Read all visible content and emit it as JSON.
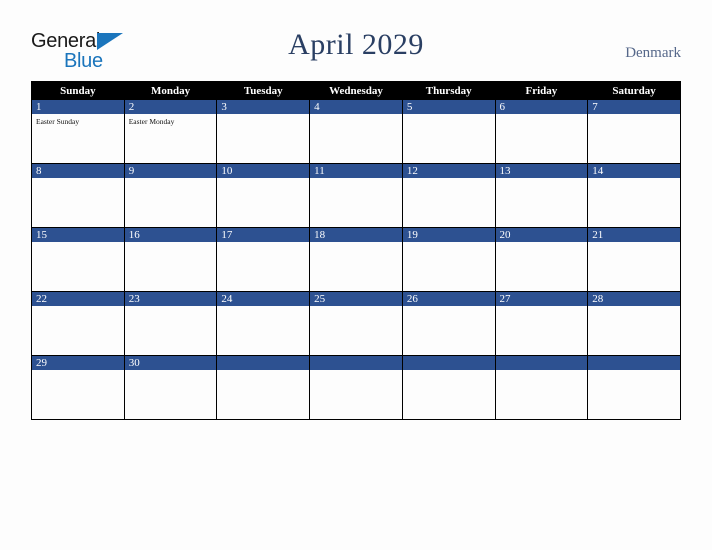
{
  "brand": {
    "word_one": "General",
    "word_two": "Blue",
    "triangle_icon": "triangle-icon",
    "accent_color": "#1b75bc"
  },
  "header": {
    "title": "April 2029",
    "country": "Denmark",
    "title_color": "#2a3f63",
    "country_color": "#56688a"
  },
  "calendar": {
    "weekday_headers": [
      "Sunday",
      "Monday",
      "Tuesday",
      "Wednesday",
      "Thursday",
      "Friday",
      "Saturday"
    ],
    "header_bg": "#000000",
    "header_text_color": "#ffffff",
    "daynum_bar_color": "#2d5191",
    "daynum_text_color": "#ffffff",
    "grid_line_color": "#000000",
    "cell_bg": "#fdfdfd",
    "weeks": [
      [
        {
          "day": "1",
          "events": [
            "Easter Sunday"
          ]
        },
        {
          "day": "2",
          "events": [
            "Easter Monday"
          ]
        },
        {
          "day": "3",
          "events": []
        },
        {
          "day": "4",
          "events": []
        },
        {
          "day": "5",
          "events": []
        },
        {
          "day": "6",
          "events": []
        },
        {
          "day": "7",
          "events": []
        }
      ],
      [
        {
          "day": "8",
          "events": []
        },
        {
          "day": "9",
          "events": []
        },
        {
          "day": "10",
          "events": []
        },
        {
          "day": "11",
          "events": []
        },
        {
          "day": "12",
          "events": []
        },
        {
          "day": "13",
          "events": []
        },
        {
          "day": "14",
          "events": []
        }
      ],
      [
        {
          "day": "15",
          "events": []
        },
        {
          "day": "16",
          "events": []
        },
        {
          "day": "17",
          "events": []
        },
        {
          "day": "18",
          "events": []
        },
        {
          "day": "19",
          "events": []
        },
        {
          "day": "20",
          "events": []
        },
        {
          "day": "21",
          "events": []
        }
      ],
      [
        {
          "day": "22",
          "events": []
        },
        {
          "day": "23",
          "events": []
        },
        {
          "day": "24",
          "events": []
        },
        {
          "day": "25",
          "events": []
        },
        {
          "day": "26",
          "events": []
        },
        {
          "day": "27",
          "events": []
        },
        {
          "day": "28",
          "events": []
        }
      ],
      [
        {
          "day": "29",
          "events": []
        },
        {
          "day": "30",
          "events": []
        },
        {
          "day": "",
          "events": []
        },
        {
          "day": "",
          "events": []
        },
        {
          "day": "",
          "events": []
        },
        {
          "day": "",
          "events": []
        },
        {
          "day": "",
          "events": []
        }
      ]
    ]
  }
}
